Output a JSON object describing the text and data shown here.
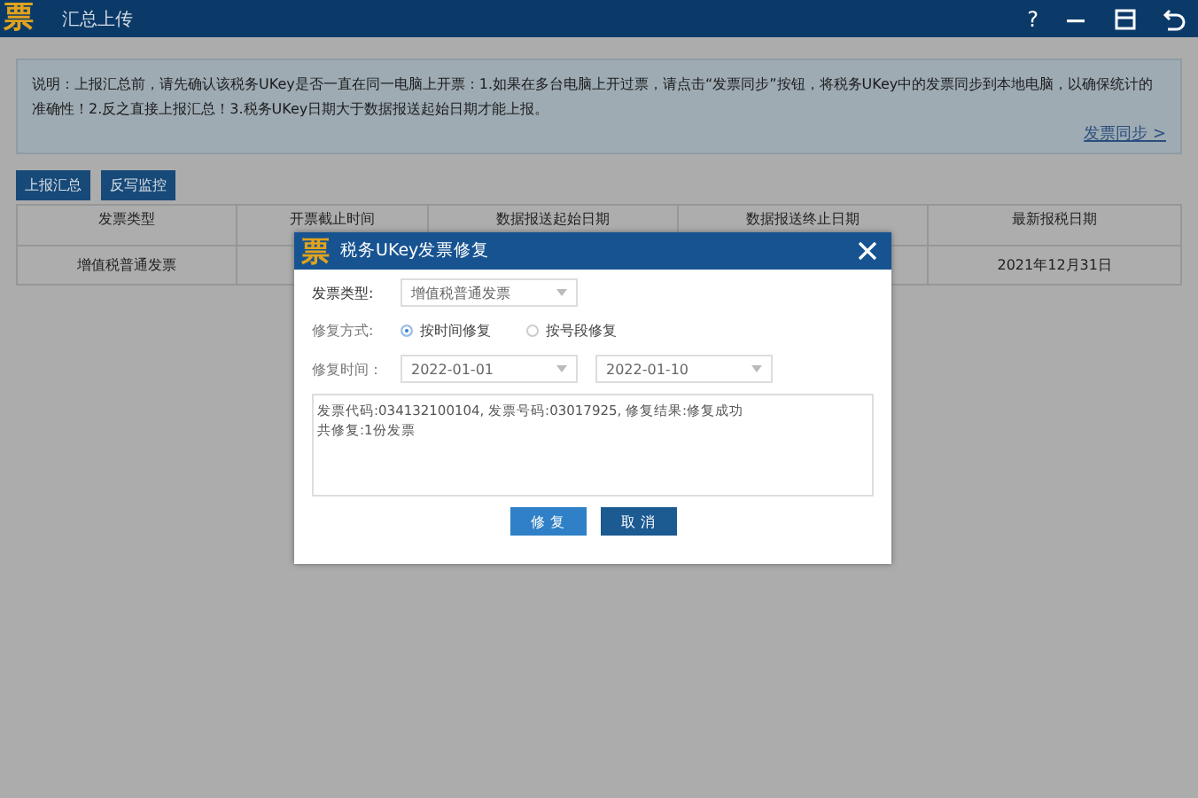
{
  "window": {
    "logo": "票",
    "title": "汇总上传",
    "controls": [
      "?"
    ]
  },
  "notice": {
    "text": "说明：上报汇总前，请先确认该税务UKey是否一直在同一电脑上开票：1.如果在多台电脑上开过票，请点击“发票同步”按钮，将税务UKey中的发票同步到本地电脑，以确保统计的准确性！2.反之直接上报汇总！3.税务UKey日期大于数据报送起始日期才能上报。",
    "link": "发票同步 >"
  },
  "actions": [
    "上报汇总",
    "反写监控"
  ],
  "table": {
    "columns": [
      "发票类型",
      "开票截止时间",
      "数据报送起始日期",
      "数据报送终止日期",
      "最新报税日期"
    ],
    "rows": [
      [
        "增值税普通发票",
        "",
        "",
        "",
        "2021年12月31日"
      ]
    ]
  },
  "dialog": {
    "logo": "票",
    "title": "税务UKey发票修复",
    "invoice_type": {
      "label": "发票类型:",
      "value": "增值税普通发票"
    },
    "mode": {
      "label": "修复方式:",
      "options": [
        {
          "label": "按时间修复",
          "selected": true
        },
        {
          "label": "按号段修复",
          "selected": false
        }
      ]
    },
    "period": {
      "label": "修复时间：",
      "start": "2022-01-01",
      "end": "2022-01-10"
    },
    "log": [
      "发票代码:034132100104, 发票号码:03017925, 修复结果:修复成功",
      "共修复:1份发票"
    ],
    "buttons": [
      {
        "label": "修 复",
        "kind": "primary"
      },
      {
        "label": "取 消",
        "kind": "secondary"
      }
    ]
  }
}
